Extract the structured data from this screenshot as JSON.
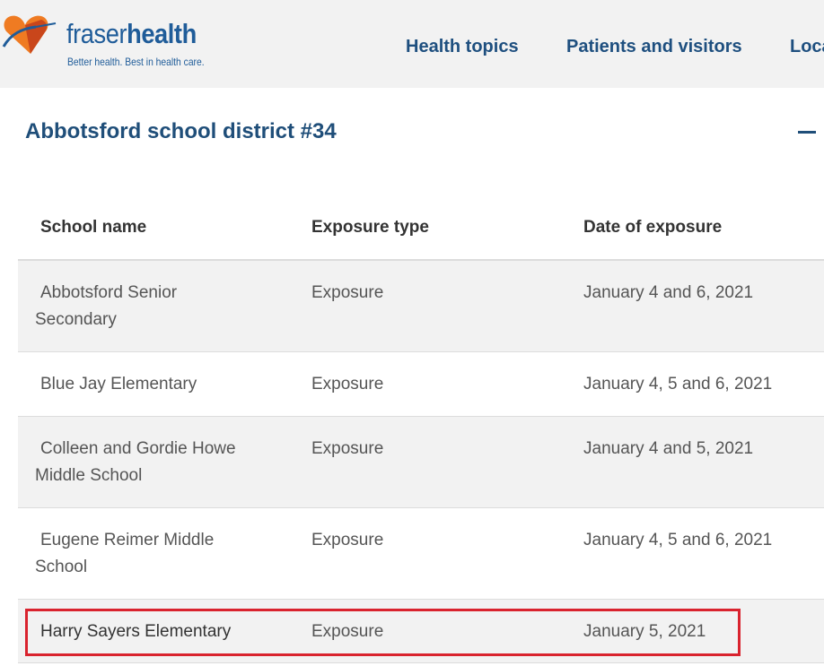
{
  "header": {
    "logo": {
      "word_part1": "fraser",
      "word_part2": "health",
      "tagline": "Better health. Best in health care.",
      "colors": {
        "heart_orange": "#ef7b22",
        "heart_dark": "#c9461b",
        "text_blue": "#1f5c99"
      }
    },
    "nav": [
      {
        "label": "Health topics"
      },
      {
        "label": "Patients and visitors"
      },
      {
        "label": "Loca"
      }
    ]
  },
  "section": {
    "title": "Abbotsford school district #34",
    "collapse_icon": "minus-icon"
  },
  "table": {
    "columns": [
      "School name",
      "Exposure type",
      "Date of exposure"
    ],
    "rows": [
      {
        "school_line1": "Abbotsford Senior",
        "school_line2": "Secondary",
        "type": "Exposure",
        "date": "January 4 and 6, 2021"
      },
      {
        "school_line1": "Blue Jay Elementary",
        "school_line2": "",
        "type": "Exposure",
        "date": "January 4, 5 and 6, 2021"
      },
      {
        "school_line1": "Colleen and Gordie Howe",
        "school_line2": "Middle School",
        "type": "Exposure",
        "date": "January 4 and 5, 2021"
      },
      {
        "school_line1": "Eugene Reimer Middle",
        "school_line2": "School",
        "type": "Exposure",
        "date": "January 4, 5 and 6, 2021"
      },
      {
        "school_line1": "Harry Sayers Elementary",
        "school_line2": "",
        "type": "Exposure",
        "date": "January 5, 2021"
      }
    ]
  },
  "colors": {
    "header_bg": "#f2f2f2",
    "nav_text": "#1e4f7f",
    "title_text": "#1f4e79",
    "alt_row_bg": "#f2f2f2",
    "highlight_box": "#d9232e"
  }
}
